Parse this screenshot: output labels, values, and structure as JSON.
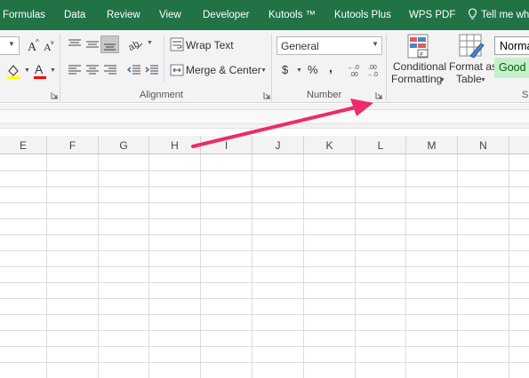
{
  "tabs": [
    {
      "label": "Formulas"
    },
    {
      "label": "Data"
    },
    {
      "label": "Review"
    },
    {
      "label": "View"
    },
    {
      "label": "Developer"
    },
    {
      "label": "Kutools ™"
    },
    {
      "label": "Kutools Plus"
    },
    {
      "label": "WPS PDF"
    }
  ],
  "tell_me": "Tell me wh",
  "alignment": {
    "wrap_text": "Wrap Text",
    "merge_center": "Merge & Center",
    "group_label": "Alignment"
  },
  "number": {
    "format_value": "General",
    "currency_symbol": "$",
    "percent_symbol": "%",
    "comma_symbol": ",",
    "increase_decimal": "←.0\n.00",
    "decrease_decimal": ".00\n→.0",
    "group_label": "Number"
  },
  "styles": {
    "conditional_formatting_line1": "Conditional",
    "conditional_formatting_line2": "Formatting",
    "format_as_table_line1": "Format as",
    "format_as_table_line2": "Table",
    "normal": "Norma",
    "good": "Good",
    "group_label_partial": "S"
  },
  "columns": [
    "E",
    "F",
    "G",
    "H",
    "I",
    "J",
    "K",
    "L",
    "M",
    "N"
  ],
  "colors": {
    "ribbon_tab_bg": "#217346",
    "arrow": "#ee2a6b",
    "good_fill": "#c6efce",
    "good_text": "#006100",
    "font_color_bar": "#ff0000",
    "fill_color_bar": "#ffff00"
  }
}
